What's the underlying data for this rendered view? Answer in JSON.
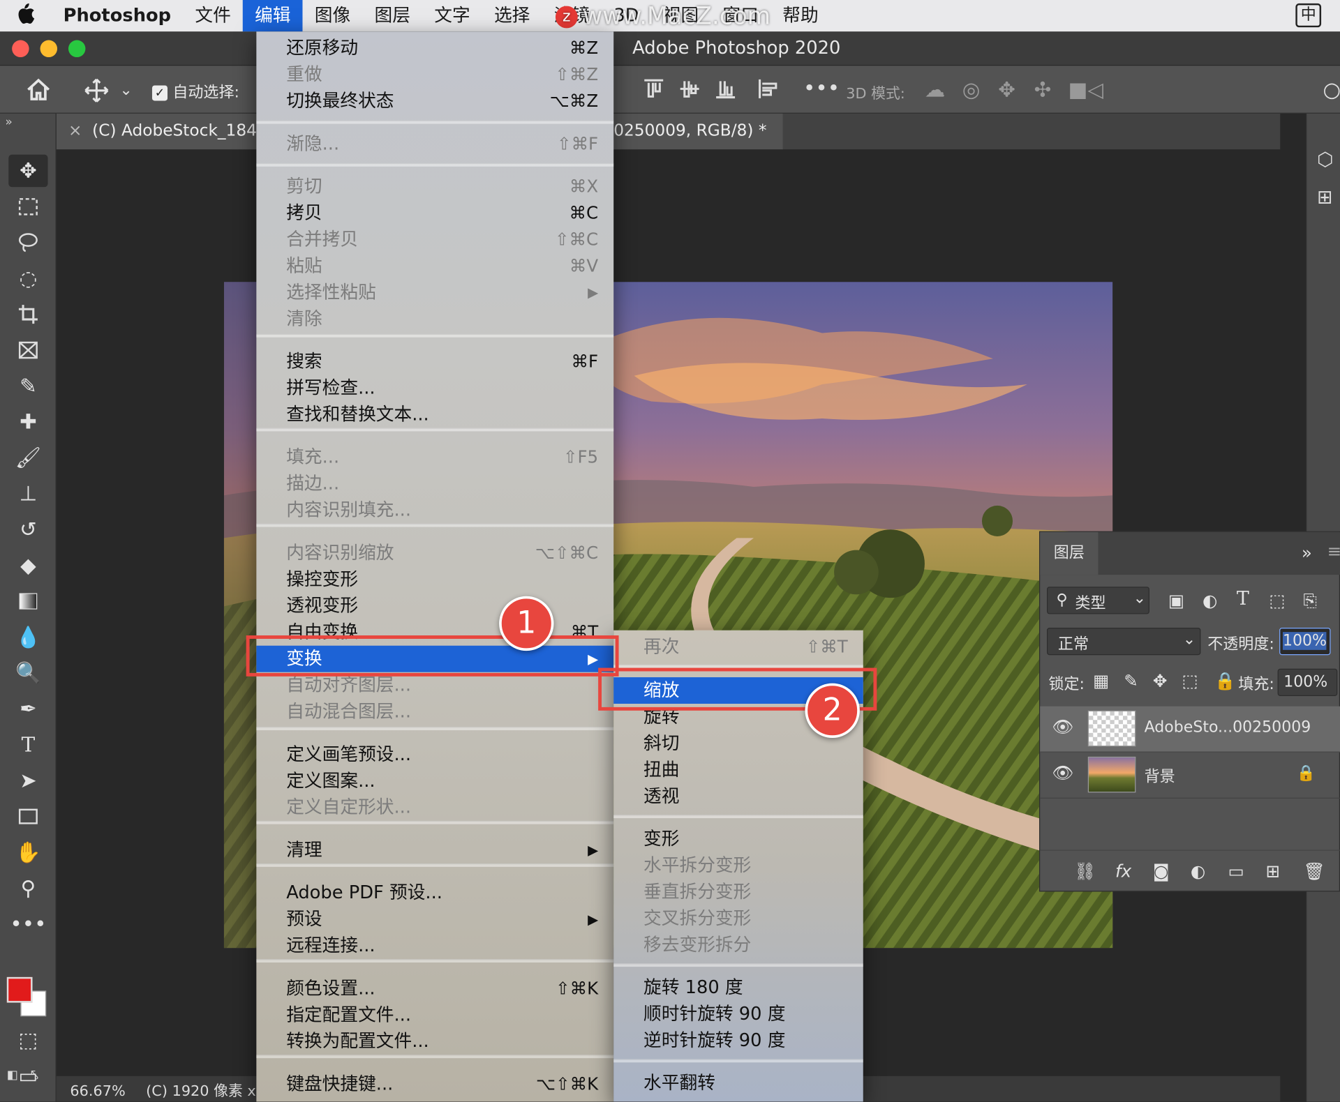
{
  "menubar": {
    "apple": "",
    "app": "Photoshop",
    "items": [
      "文件",
      "编辑",
      "图像",
      "图层",
      "文字",
      "选择",
      "滤镜",
      "3D",
      "视图",
      "窗口",
      "帮助"
    ],
    "active_index": 1,
    "input_method": "中"
  },
  "watermark": {
    "z": "z",
    "text": "www.MacZ.com"
  },
  "window": {
    "title": "Adobe Photoshop 2020"
  },
  "options_bar": {
    "auto_select_label": "自动选择:",
    "auto_select_checked": "✓",
    "mode3d_label": "3D 模式:"
  },
  "doc_tab": {
    "close": "×",
    "title": "(C) AdobeStock_1847",
    "title_tail": "0250009, RGB/8) *"
  },
  "edit_menu": {
    "items": [
      {
        "label": "还原移动",
        "shortcut": "⌘Z",
        "enabled": true
      },
      {
        "label": "重做",
        "shortcut": "⇧⌘Z",
        "enabled": false
      },
      {
        "label": "切换最终状态",
        "shortcut": "⌥⌘Z",
        "enabled": true
      },
      {
        "label": "渐隐...",
        "shortcut": "⇧⌘F",
        "enabled": false
      },
      {
        "label": "剪切",
        "shortcut": "⌘X",
        "enabled": false
      },
      {
        "label": "拷贝",
        "shortcut": "⌘C",
        "enabled": true
      },
      {
        "label": "合并拷贝",
        "shortcut": "⇧⌘C",
        "enabled": false
      },
      {
        "label": "粘贴",
        "shortcut": "⌘V",
        "enabled": false
      },
      {
        "label": "选择性粘贴",
        "shortcut": "▶",
        "enabled": false
      },
      {
        "label": "清除",
        "shortcut": "",
        "enabled": false
      },
      {
        "label": "搜索",
        "shortcut": "⌘F",
        "enabled": true
      },
      {
        "label": "拼写检查...",
        "shortcut": "",
        "enabled": true
      },
      {
        "label": "查找和替换文本...",
        "shortcut": "",
        "enabled": true
      },
      {
        "label": "填充...",
        "shortcut": "⇧F5",
        "enabled": false
      },
      {
        "label": "描边...",
        "shortcut": "",
        "enabled": false
      },
      {
        "label": "内容识别填充...",
        "shortcut": "",
        "enabled": false
      },
      {
        "label": "内容识别缩放",
        "shortcut": "⌥⇧⌘C",
        "enabled": false
      },
      {
        "label": "操控变形",
        "shortcut": "",
        "enabled": true
      },
      {
        "label": "透视变形",
        "shortcut": "",
        "enabled": true
      },
      {
        "label": "自由变换",
        "shortcut": "⌘T",
        "enabled": true
      },
      {
        "label": "变换",
        "shortcut": "▶",
        "enabled": true,
        "highlighted": true
      },
      {
        "label": "自动对齐图层...",
        "shortcut": "",
        "enabled": false
      },
      {
        "label": "自动混合图层...",
        "shortcut": "",
        "enabled": false
      },
      {
        "label": "定义画笔预设...",
        "shortcut": "",
        "enabled": true
      },
      {
        "label": "定义图案...",
        "shortcut": "",
        "enabled": true
      },
      {
        "label": "定义自定形状...",
        "shortcut": "",
        "enabled": false
      },
      {
        "label": "清理",
        "shortcut": "▶",
        "enabled": true
      },
      {
        "label": "Adobe PDF 预设...",
        "shortcut": "",
        "enabled": true
      },
      {
        "label": "预设",
        "shortcut": "▶",
        "enabled": true
      },
      {
        "label": "远程连接...",
        "shortcut": "",
        "enabled": true
      },
      {
        "label": "颜色设置...",
        "shortcut": "⇧⌘K",
        "enabled": true
      },
      {
        "label": "指定配置文件...",
        "shortcut": "",
        "enabled": true
      },
      {
        "label": "转换为配置文件...",
        "shortcut": "",
        "enabled": true
      },
      {
        "label": "键盘快捷键...",
        "shortcut": "⌥⇧⌘K",
        "enabled": true
      }
    ]
  },
  "transform_submenu": {
    "items": [
      {
        "label": "再次",
        "shortcut": "⇧⌘T",
        "enabled": false
      },
      {
        "label": "缩放",
        "shortcut": "",
        "enabled": true,
        "highlighted": true
      },
      {
        "label": "旋转",
        "shortcut": "",
        "enabled": true
      },
      {
        "label": "斜切",
        "shortcut": "",
        "enabled": true
      },
      {
        "label": "扭曲",
        "shortcut": "",
        "enabled": true
      },
      {
        "label": "透视",
        "shortcut": "",
        "enabled": true
      },
      {
        "label": "变形",
        "shortcut": "",
        "enabled": true
      },
      {
        "label": "水平拆分变形",
        "shortcut": "",
        "enabled": false
      },
      {
        "label": "垂直拆分变形",
        "shortcut": "",
        "enabled": false
      },
      {
        "label": "交叉拆分变形",
        "shortcut": "",
        "enabled": false
      },
      {
        "label": "移去变形拆分",
        "shortcut": "",
        "enabled": false
      },
      {
        "label": "旋转 180 度",
        "shortcut": "",
        "enabled": true
      },
      {
        "label": "顺时针旋转 90 度",
        "shortcut": "",
        "enabled": true
      },
      {
        "label": "逆时针旋转 90 度",
        "shortcut": "",
        "enabled": true
      },
      {
        "label": "水平翻转",
        "shortcut": "",
        "enabled": true
      }
    ]
  },
  "callouts": [
    "1",
    "2"
  ],
  "layers_panel": {
    "title": "图层",
    "collapse": "»",
    "filter_label": "类型",
    "blend_mode": "正常",
    "opacity_label": "不透明度:",
    "opacity_value": "100%",
    "lock_label": "锁定:",
    "fill_label": "填充:",
    "fill_value": "100%",
    "layers": [
      {
        "name": "AdobeSto...00250009",
        "selected": true,
        "locked": false
      },
      {
        "name": "背景",
        "selected": false,
        "locked": true
      }
    ],
    "footer_icons": [
      "link-icon",
      "fx-icon",
      "mask-icon",
      "adjustment-icon",
      "folder-icon",
      "new-layer-icon",
      "trash-icon"
    ],
    "fx_label": "fx"
  },
  "status_bar": {
    "zoom": "66.67%",
    "info": "(C) 1920 像素 x"
  },
  "colors": {
    "accent": "#1d63d6",
    "callout": "#e8463e",
    "foreground": "#e11b1b",
    "background": "#ffffff"
  }
}
